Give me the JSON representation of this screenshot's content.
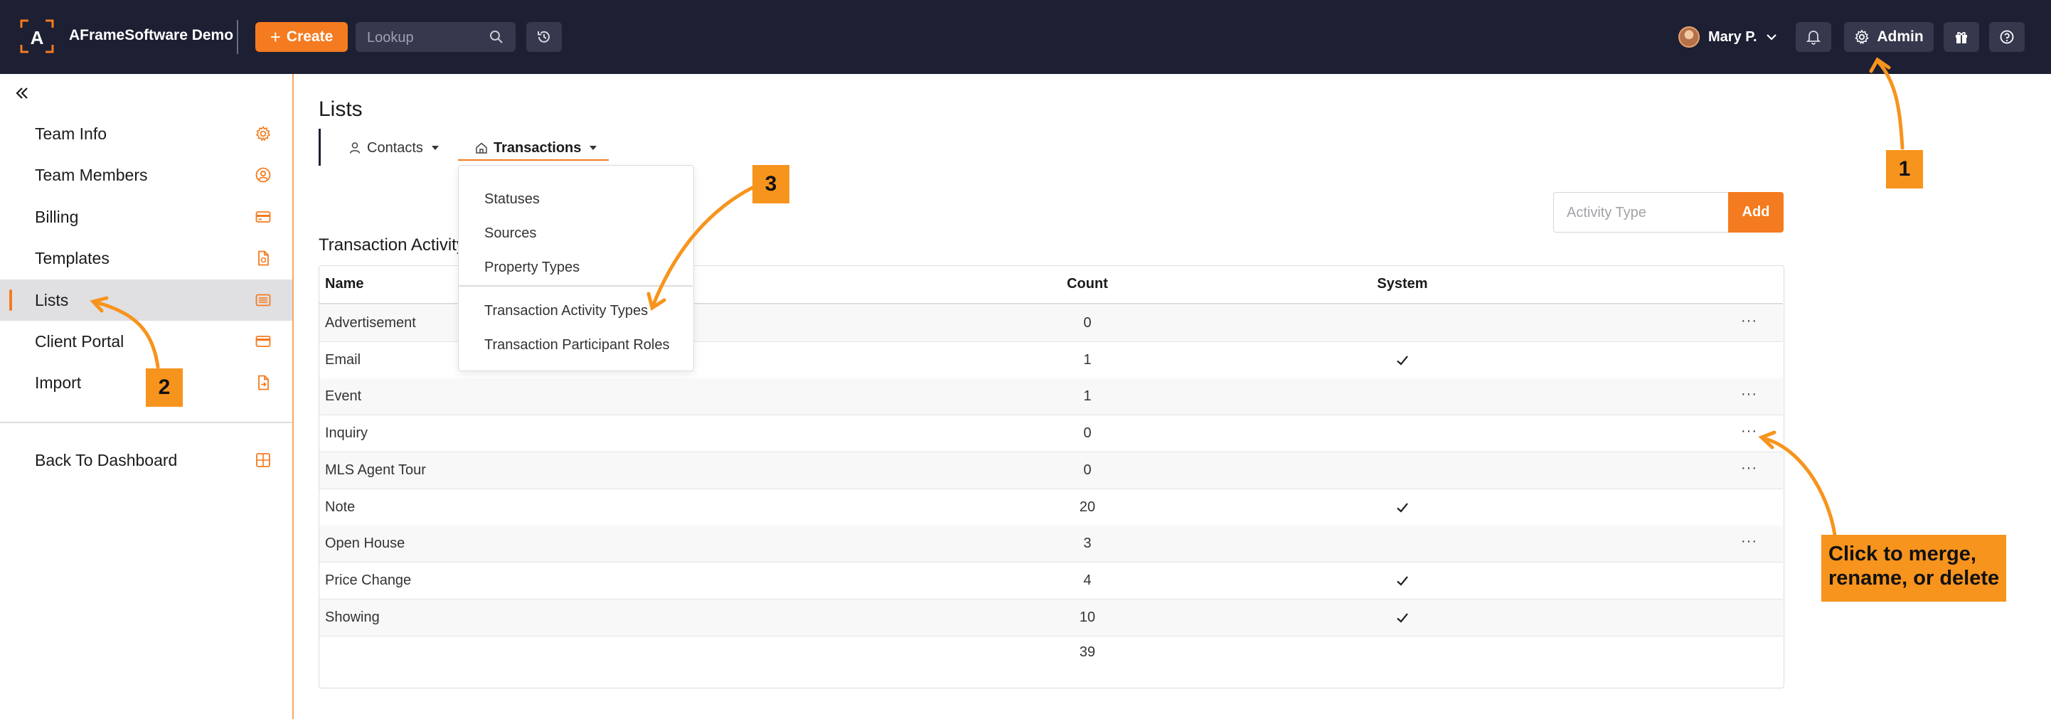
{
  "topbar": {
    "app_title": "AFrameSoftware Demo",
    "create_label": "Create",
    "lookup_placeholder": "Lookup",
    "user_name": "Mary P.",
    "admin_label": "Admin"
  },
  "sidebar": {
    "items": [
      {
        "label": "Team Info",
        "icon": "gear-icon"
      },
      {
        "label": "Team Members",
        "icon": "user-circle-icon"
      },
      {
        "label": "Billing",
        "icon": "credit-card-icon"
      },
      {
        "label": "Templates",
        "icon": "file-icon"
      },
      {
        "label": "Lists",
        "icon": "list-icon"
      },
      {
        "label": "Client Portal",
        "icon": "card-icon"
      },
      {
        "label": "Import",
        "icon": "file-import-icon"
      }
    ],
    "back_label": "Back To Dashboard",
    "active_index": 4
  },
  "main": {
    "title": "Lists",
    "tabs": [
      {
        "label": "Contacts"
      },
      {
        "label": "Transactions"
      }
    ],
    "dropdown": {
      "items": [
        "Statuses",
        "Sources",
        "Property Types",
        "Transaction Activity Types",
        "Transaction Participant Roles"
      ]
    },
    "activity_input_placeholder": "Activity Type",
    "add_label": "Add",
    "section_title": "Transaction Activity Types",
    "table": {
      "headers": {
        "name": "Name",
        "count": "Count",
        "system": "System"
      },
      "rows": [
        {
          "name": "Advertisement",
          "count": "0",
          "system": false,
          "menu": true
        },
        {
          "name": "Email",
          "count": "1",
          "system": true,
          "menu": false
        },
        {
          "name": "Event",
          "count": "1",
          "system": false,
          "menu": true
        },
        {
          "name": "Inquiry",
          "count": "0",
          "system": false,
          "menu": true
        },
        {
          "name": "MLS Agent Tour",
          "count": "0",
          "system": false,
          "menu": true
        },
        {
          "name": "Note",
          "count": "20",
          "system": true,
          "menu": false
        },
        {
          "name": "Open House",
          "count": "3",
          "system": false,
          "menu": true
        },
        {
          "name": "Price Change",
          "count": "4",
          "system": true,
          "menu": false
        },
        {
          "name": "Showing",
          "count": "10",
          "system": true,
          "menu": false
        }
      ],
      "total": "39",
      "more_glyph": "···"
    }
  },
  "annotations": {
    "step1": "1",
    "step2": "2",
    "step3": "3",
    "note": "Click to merge, rename, or delete"
  },
  "colors": {
    "topbar": "#1d1f33",
    "accent": "#f47b1f",
    "annotation": "#f7941d"
  }
}
